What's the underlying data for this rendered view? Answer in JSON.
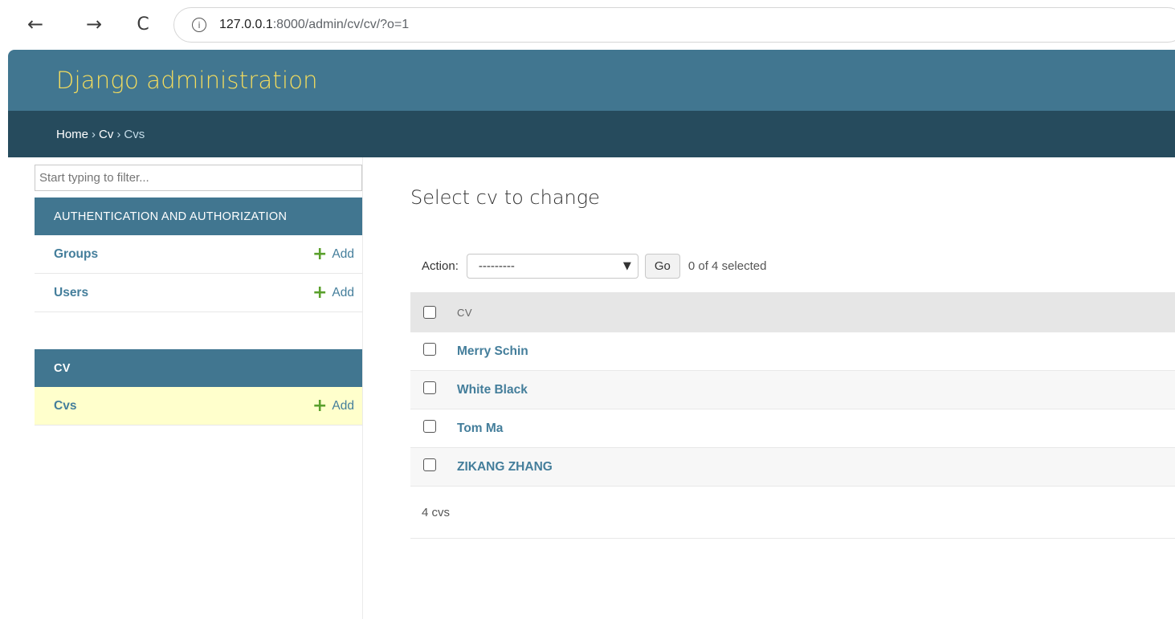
{
  "browser": {
    "url_host": "127.0.0.1",
    "url_rest": ":8000/admin/cv/cv/?o=1",
    "back_glyph": "←",
    "forward_glyph": "→",
    "reload_glyph": "C",
    "info_glyph": "i"
  },
  "header": {
    "branding": "Django administration"
  },
  "breadcrumbs": {
    "home": "Home",
    "app": "Cv",
    "current": "Cvs",
    "separator": "›"
  },
  "sidebar": {
    "filter_placeholder": "Start typing to filter...",
    "modules": [
      {
        "caption": "AUTHENTICATION AND AUTHORIZATION",
        "rows": [
          {
            "label": "Groups",
            "add": "Add"
          },
          {
            "label": "Users",
            "add": "Add"
          }
        ]
      },
      {
        "caption": "CV",
        "rows": [
          {
            "label": "Cvs",
            "add": "Add"
          }
        ]
      }
    ]
  },
  "content": {
    "title": "Select cv to change",
    "actions": {
      "label": "Action:",
      "selected_option": "---------",
      "go_label": "Go",
      "counter": "0 of 4 selected"
    },
    "table": {
      "column": "CV",
      "rows": [
        "Merry Schin",
        "White Black",
        "Tom Ma",
        "ZIKANG ZHANG"
      ]
    },
    "paginator": "4 cvs"
  },
  "colors": {
    "header_bg": "#417690",
    "breadcrumbs_bg": "#264b5d",
    "branding": "#f5dd5d",
    "link": "#447e9b",
    "add_plus": "#5aa02c",
    "current_row": "#ffffcc"
  }
}
